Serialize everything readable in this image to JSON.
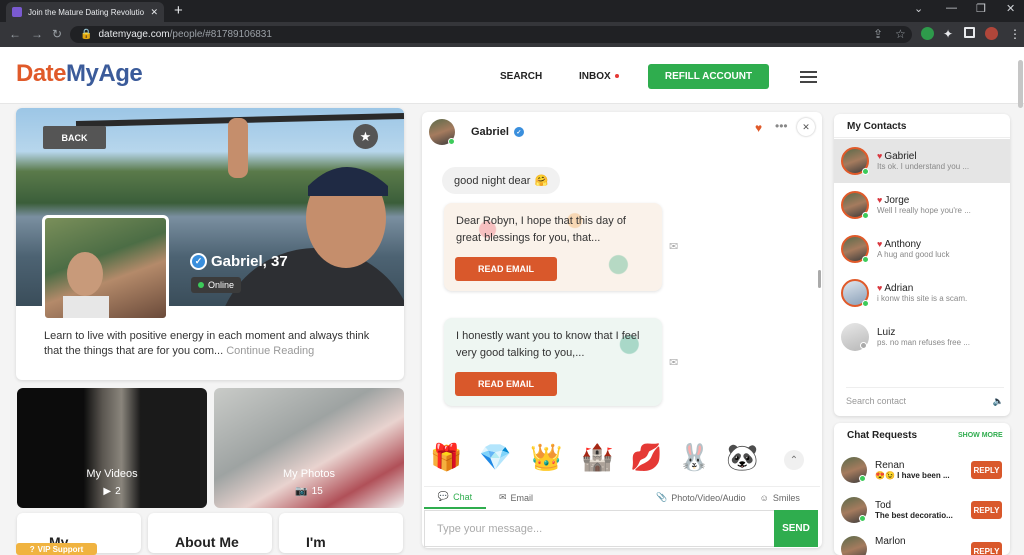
{
  "browser": {
    "tab_title": "Join the Mature Dating Revolutio",
    "url_host": "datemyage.com",
    "url_path": "/people/#81789106831"
  },
  "header": {
    "logo_part1": "Date",
    "logo_part2": "MyAge",
    "search": "SEARCH",
    "inbox": "INBOX",
    "refill": "REFILL ACCOUNT"
  },
  "profile": {
    "back": "BACK",
    "name": "Gabriel, 37",
    "online": "Online",
    "bio": "Learn to live with positive energy in each moment and always think that the things that are for you com...",
    "continue": "Continue Reading",
    "videos_label": "My Videos",
    "videos_count": "2",
    "photos_label": "My Photos",
    "photos_count": "15",
    "my_label": "My",
    "about_label": "About Me",
    "looking_label": "I'm",
    "vip": "VIP Support"
  },
  "chat": {
    "name": "Gabriel",
    "bubble": "good night dear",
    "email1": "Dear Robyn, I hope that this day of great blessings for you, that...",
    "email2": "I honestly want you to know that I feel very good talking to you,...",
    "read_email": "READ EMAIL",
    "tab_chat": "Chat",
    "tab_email": "Email",
    "tab_media": "Photo/Video/Audio",
    "tab_smiles": "Smiles",
    "input_placeholder": "Type your message...",
    "send": "SEND"
  },
  "contacts": {
    "title": "My Contacts",
    "items": [
      {
        "name": "Gabriel",
        "msg": "Its ok. I understand you ...",
        "favorite": true,
        "online": true
      },
      {
        "name": "Jorge",
        "msg": "Well I really hope you're ...",
        "favorite": true,
        "online": true
      },
      {
        "name": "Anthony",
        "msg": "A hug and good luck",
        "favorite": true,
        "online": true
      },
      {
        "name": "Adrian",
        "msg": "i konw this site is a scam.",
        "favorite": true,
        "online": true
      },
      {
        "name": "Luiz",
        "msg": "ps. no man refuses free ...",
        "favorite": false,
        "online": false
      }
    ],
    "search_placeholder": "Search contact"
  },
  "requests": {
    "title": "Chat Requests",
    "show_more": "SHOW MORE",
    "items": [
      {
        "name": "Renan",
        "msg": "I have been ..."
      },
      {
        "name": "Tod",
        "msg": "The best decoratio..."
      },
      {
        "name": "Marlon",
        "msg": ""
      }
    ],
    "reply": "REPLY"
  },
  "colors": {
    "brand_orange": "#e05a2a",
    "brand_blue": "#3b5b9a",
    "green": "#2fad4e",
    "reply_orange": "#d9582b"
  }
}
